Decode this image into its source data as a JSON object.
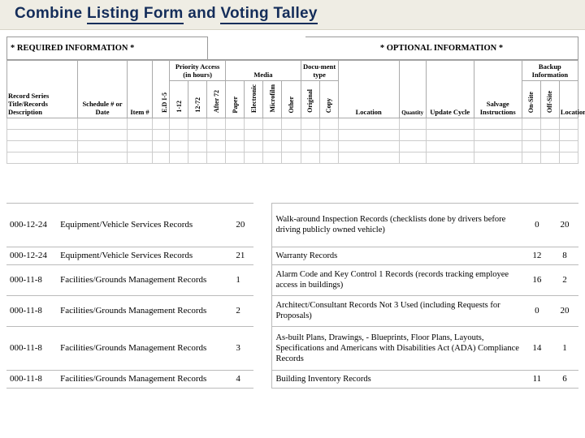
{
  "title": {
    "pre": "Combine ",
    "u1": "Listing Form",
    "mid": " and ",
    "u2": "Voting Talley"
  },
  "banner": {
    "required": "* REQUIRED INFORMATION *",
    "optional": "* OPTIONAL INFORMATION *"
  },
  "hdr": {
    "desc": "Record Series Title/Records Description",
    "sched": "Schedule # or Date",
    "item": "Item #",
    "edi": "E.D I-5",
    "priority_group": "Priority Access (in hours)",
    "media_group": "Media",
    "doc_group": "Docu-ment type",
    "backup_group": "Backup Information",
    "p1": "1-12",
    "p2": "12-72",
    "p3": "After 72",
    "m1": "Paper",
    "m2": "Electronic",
    "m3": "Microfilm",
    "m4": "Other",
    "d1": "Original",
    "d2": "Copy",
    "loc": "Location",
    "qty": "Quantity",
    "upd": "Update Cycle",
    "salv": "Salvage Instructions",
    "b1": "On-Site",
    "b2": "Off-Site",
    "bloc": "Location"
  },
  "rows": [
    {
      "id": "000-12-24",
      "name": "Equipment/Vehicle Services Records",
      "num": "20",
      "desc": "Walk-around Inspection Records (checklists done by drivers before driving publicly owned vehicle)",
      "v1": "0",
      "v2": "20",
      "h": "tall"
    },
    {
      "id": "000-12-24",
      "name": "Equipment/Vehicle Services Records",
      "num": "21",
      "desc": "Warranty Records",
      "v1": "12",
      "v2": "8",
      "h": ""
    },
    {
      "id": "000-11-8",
      "name": "Facilities/Grounds Management Records",
      "num": "1",
      "desc": "Alarm Code and Key Control 1 Records (records tracking employee access in buildings)",
      "v1": "16",
      "v2": "2",
      "h": "med"
    },
    {
      "id": "000-11-8",
      "name": "Facilities/Grounds Management Records",
      "num": "2",
      "desc": "Architect/Consultant Records Not 3 Used (including Requests for Proposals)",
      "v1": "0",
      "v2": "20",
      "h": "med"
    },
    {
      "id": "000-11-8",
      "name": "Facilities/Grounds Management Records",
      "num": "3",
      "desc": "As-built Plans, Drawings, - Blueprints, Floor Plans, Layouts, Specifications and Americans with Disabilities Act (ADA) Compliance Records",
      "v1": "14",
      "v2": "1",
      "h": "tall"
    },
    {
      "id": "000-11-8",
      "name": "Facilities/Grounds Management Records",
      "num": "4",
      "desc": "Building Inventory Records",
      "v1": "11",
      "v2": "6",
      "h": ""
    }
  ]
}
